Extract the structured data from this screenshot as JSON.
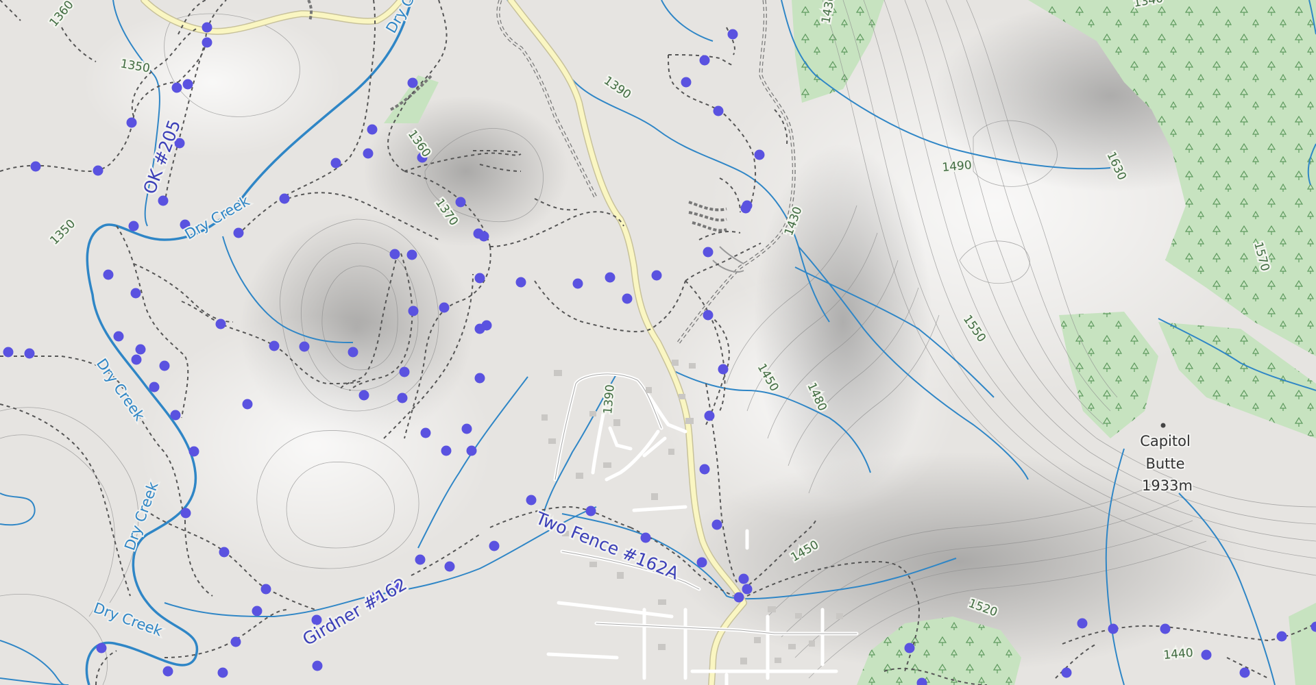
{
  "map": {
    "contour_labels": [
      "1360",
      "1350",
      "1350",
      "1390",
      "1360",
      "1370",
      "1430",
      "1490",
      "1630",
      "1550",
      "1450",
      "1480",
      "1390",
      "1450",
      "1520",
      "1570",
      "1440",
      "1430",
      "1340"
    ],
    "water_labels": [
      "Dry Creek",
      "Dry Creek",
      "Dry Creek",
      "Dry Creek",
      "Dry Creek",
      "Dry Creek"
    ],
    "trail_labels": [
      "OK #205",
      "Two Fence #162A",
      "Girdner #162"
    ],
    "peak": {
      "name_line1": "Capitol",
      "name_line2": "Butte",
      "elevation": "1933m"
    },
    "colors": {
      "background": "#e6e4e1",
      "forest": "#c7e3c0",
      "water": "#2f86c6",
      "road": "#faf6c2",
      "trail_points": "#5a52e0",
      "contour": "#8c8c8c"
    }
  }
}
